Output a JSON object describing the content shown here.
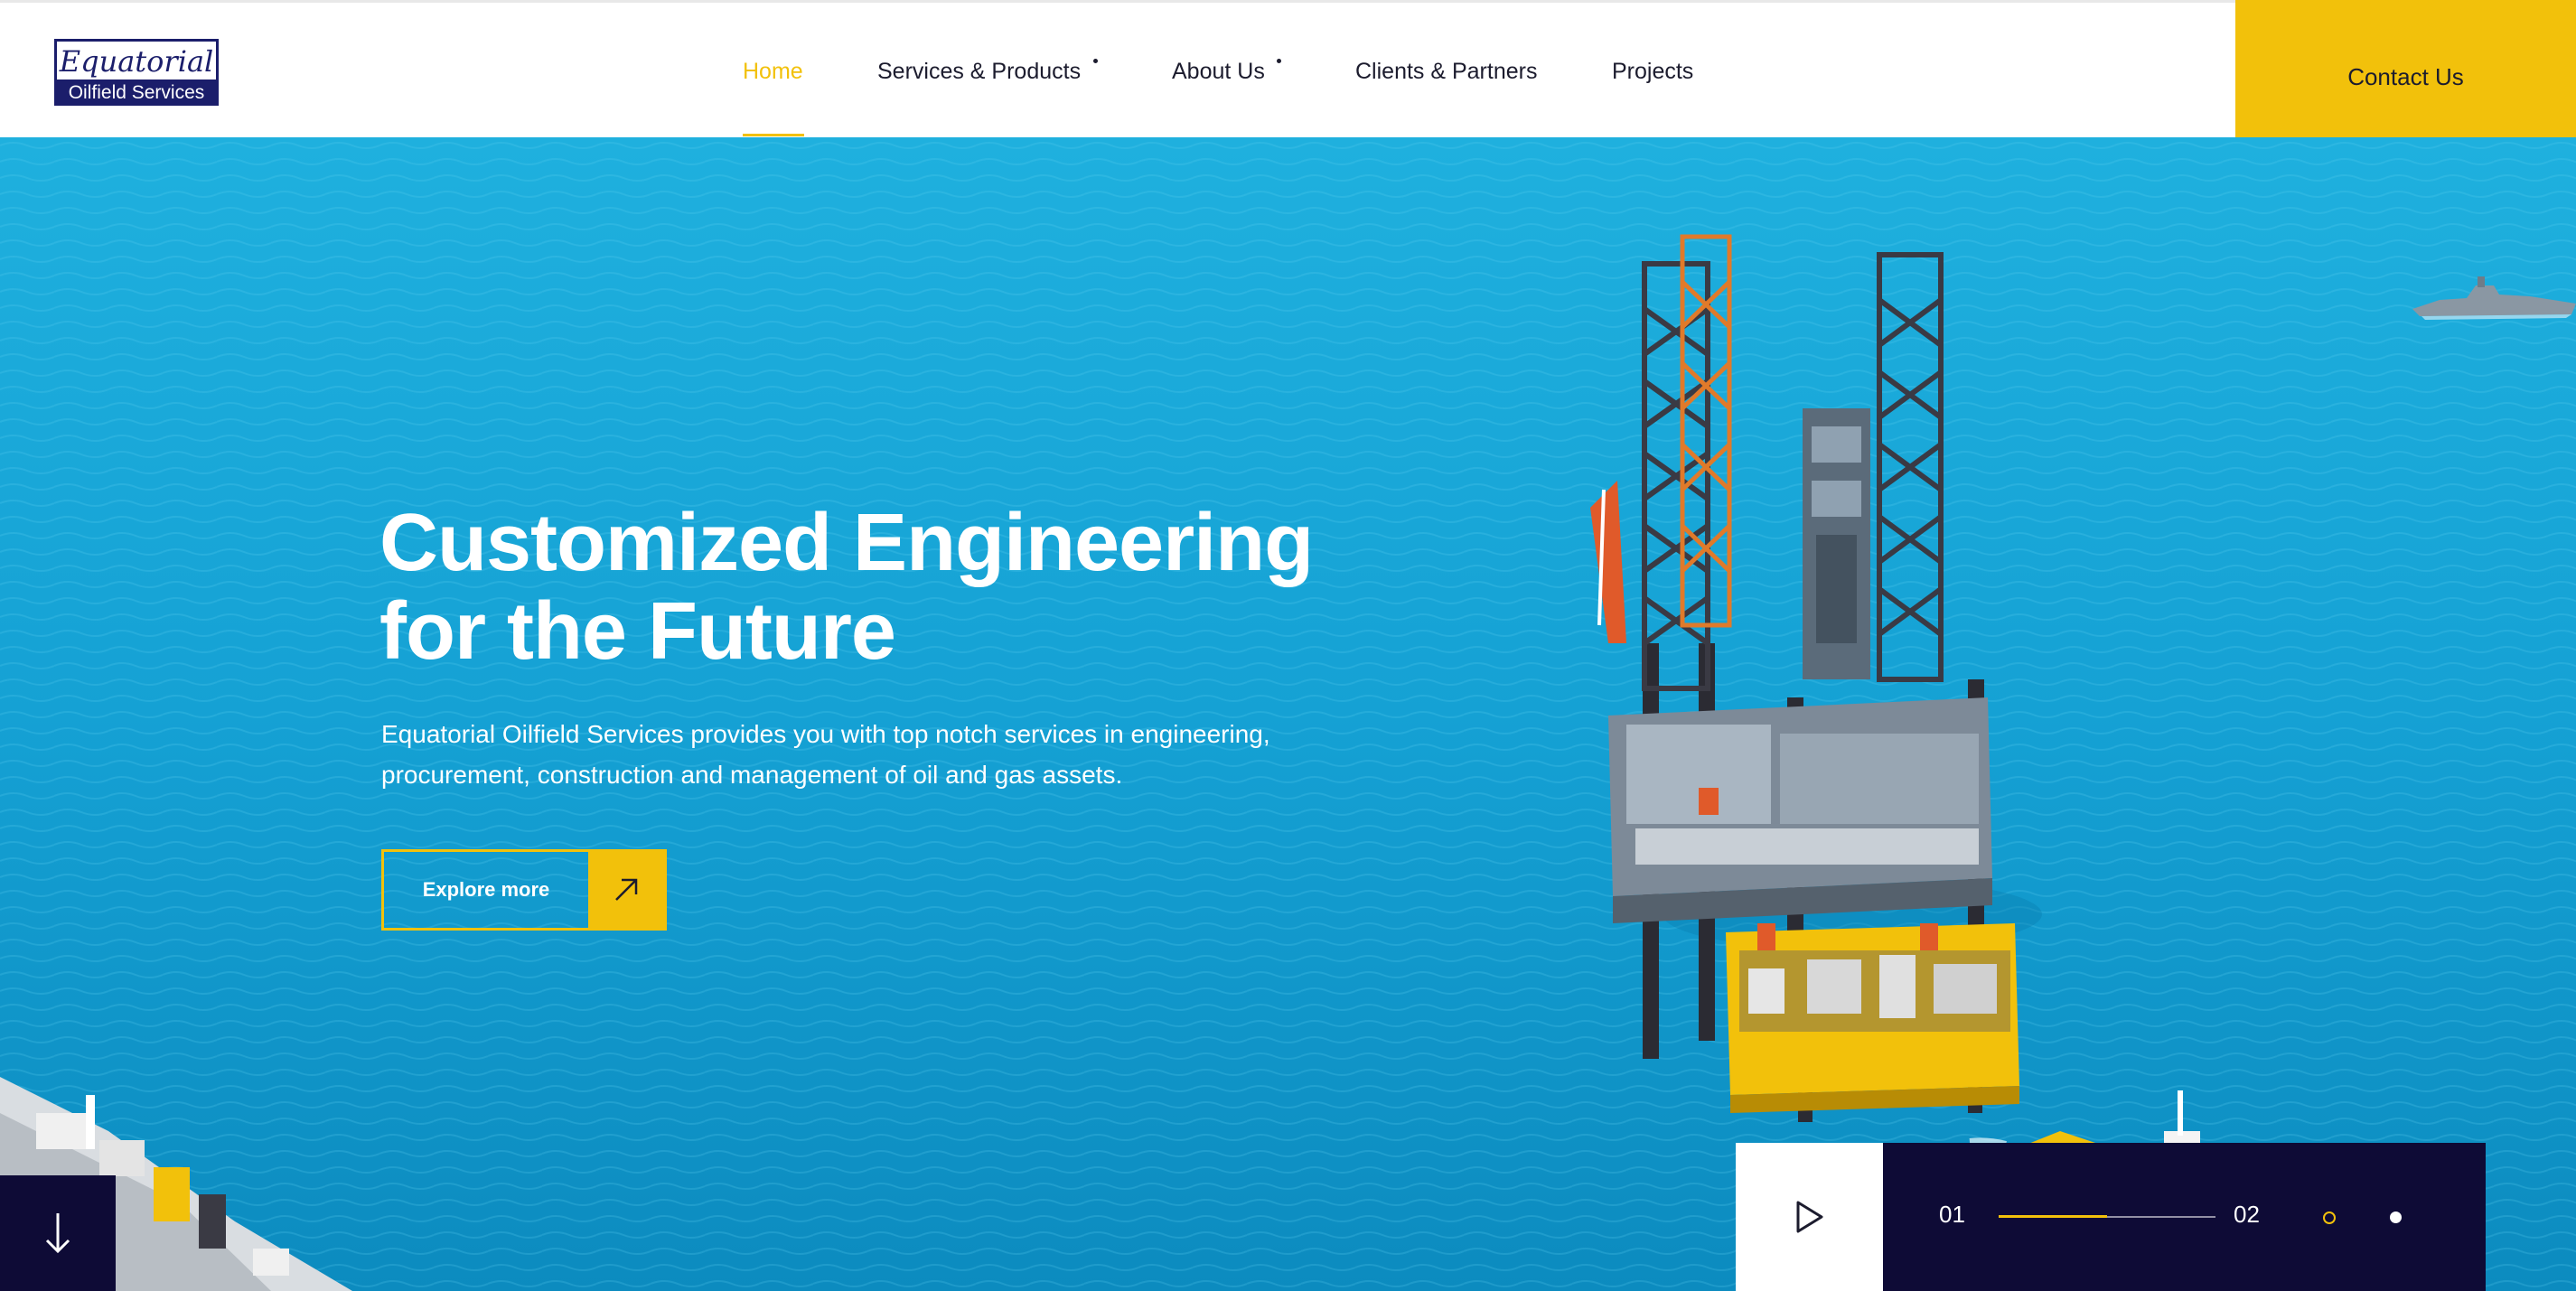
{
  "brand": {
    "logo_top": "Equatorial",
    "logo_bottom": "Oilfield Services"
  },
  "nav": {
    "items": [
      {
        "label": "Home",
        "active": true
      },
      {
        "label": "Services & Products",
        "active": false
      },
      {
        "label": "About Us",
        "active": false
      },
      {
        "label": "Clients & Partners",
        "active": false
      },
      {
        "label": "Projects",
        "active": false
      }
    ],
    "contact_label": "Contact Us"
  },
  "hero": {
    "title_line1": "Customized Engineering",
    "title_line2": "for the Future",
    "subtitle_line1": "Equatorial Oilfield Services provides you with top notch services in engineering,",
    "subtitle_line2": "procurement, construction and management of oil and gas assets.",
    "cta_label": "Explore more"
  },
  "slider": {
    "current": "01",
    "total": "02",
    "progress": 0.5
  },
  "colors": {
    "accent": "#f2c10b",
    "navy": "#0e0b36",
    "sea": "#16a0d3",
    "text_dark": "#1c1c2e"
  },
  "icons": {
    "cta": "arrow-up-right-icon",
    "scroll": "arrow-down-icon",
    "play": "play-icon"
  }
}
